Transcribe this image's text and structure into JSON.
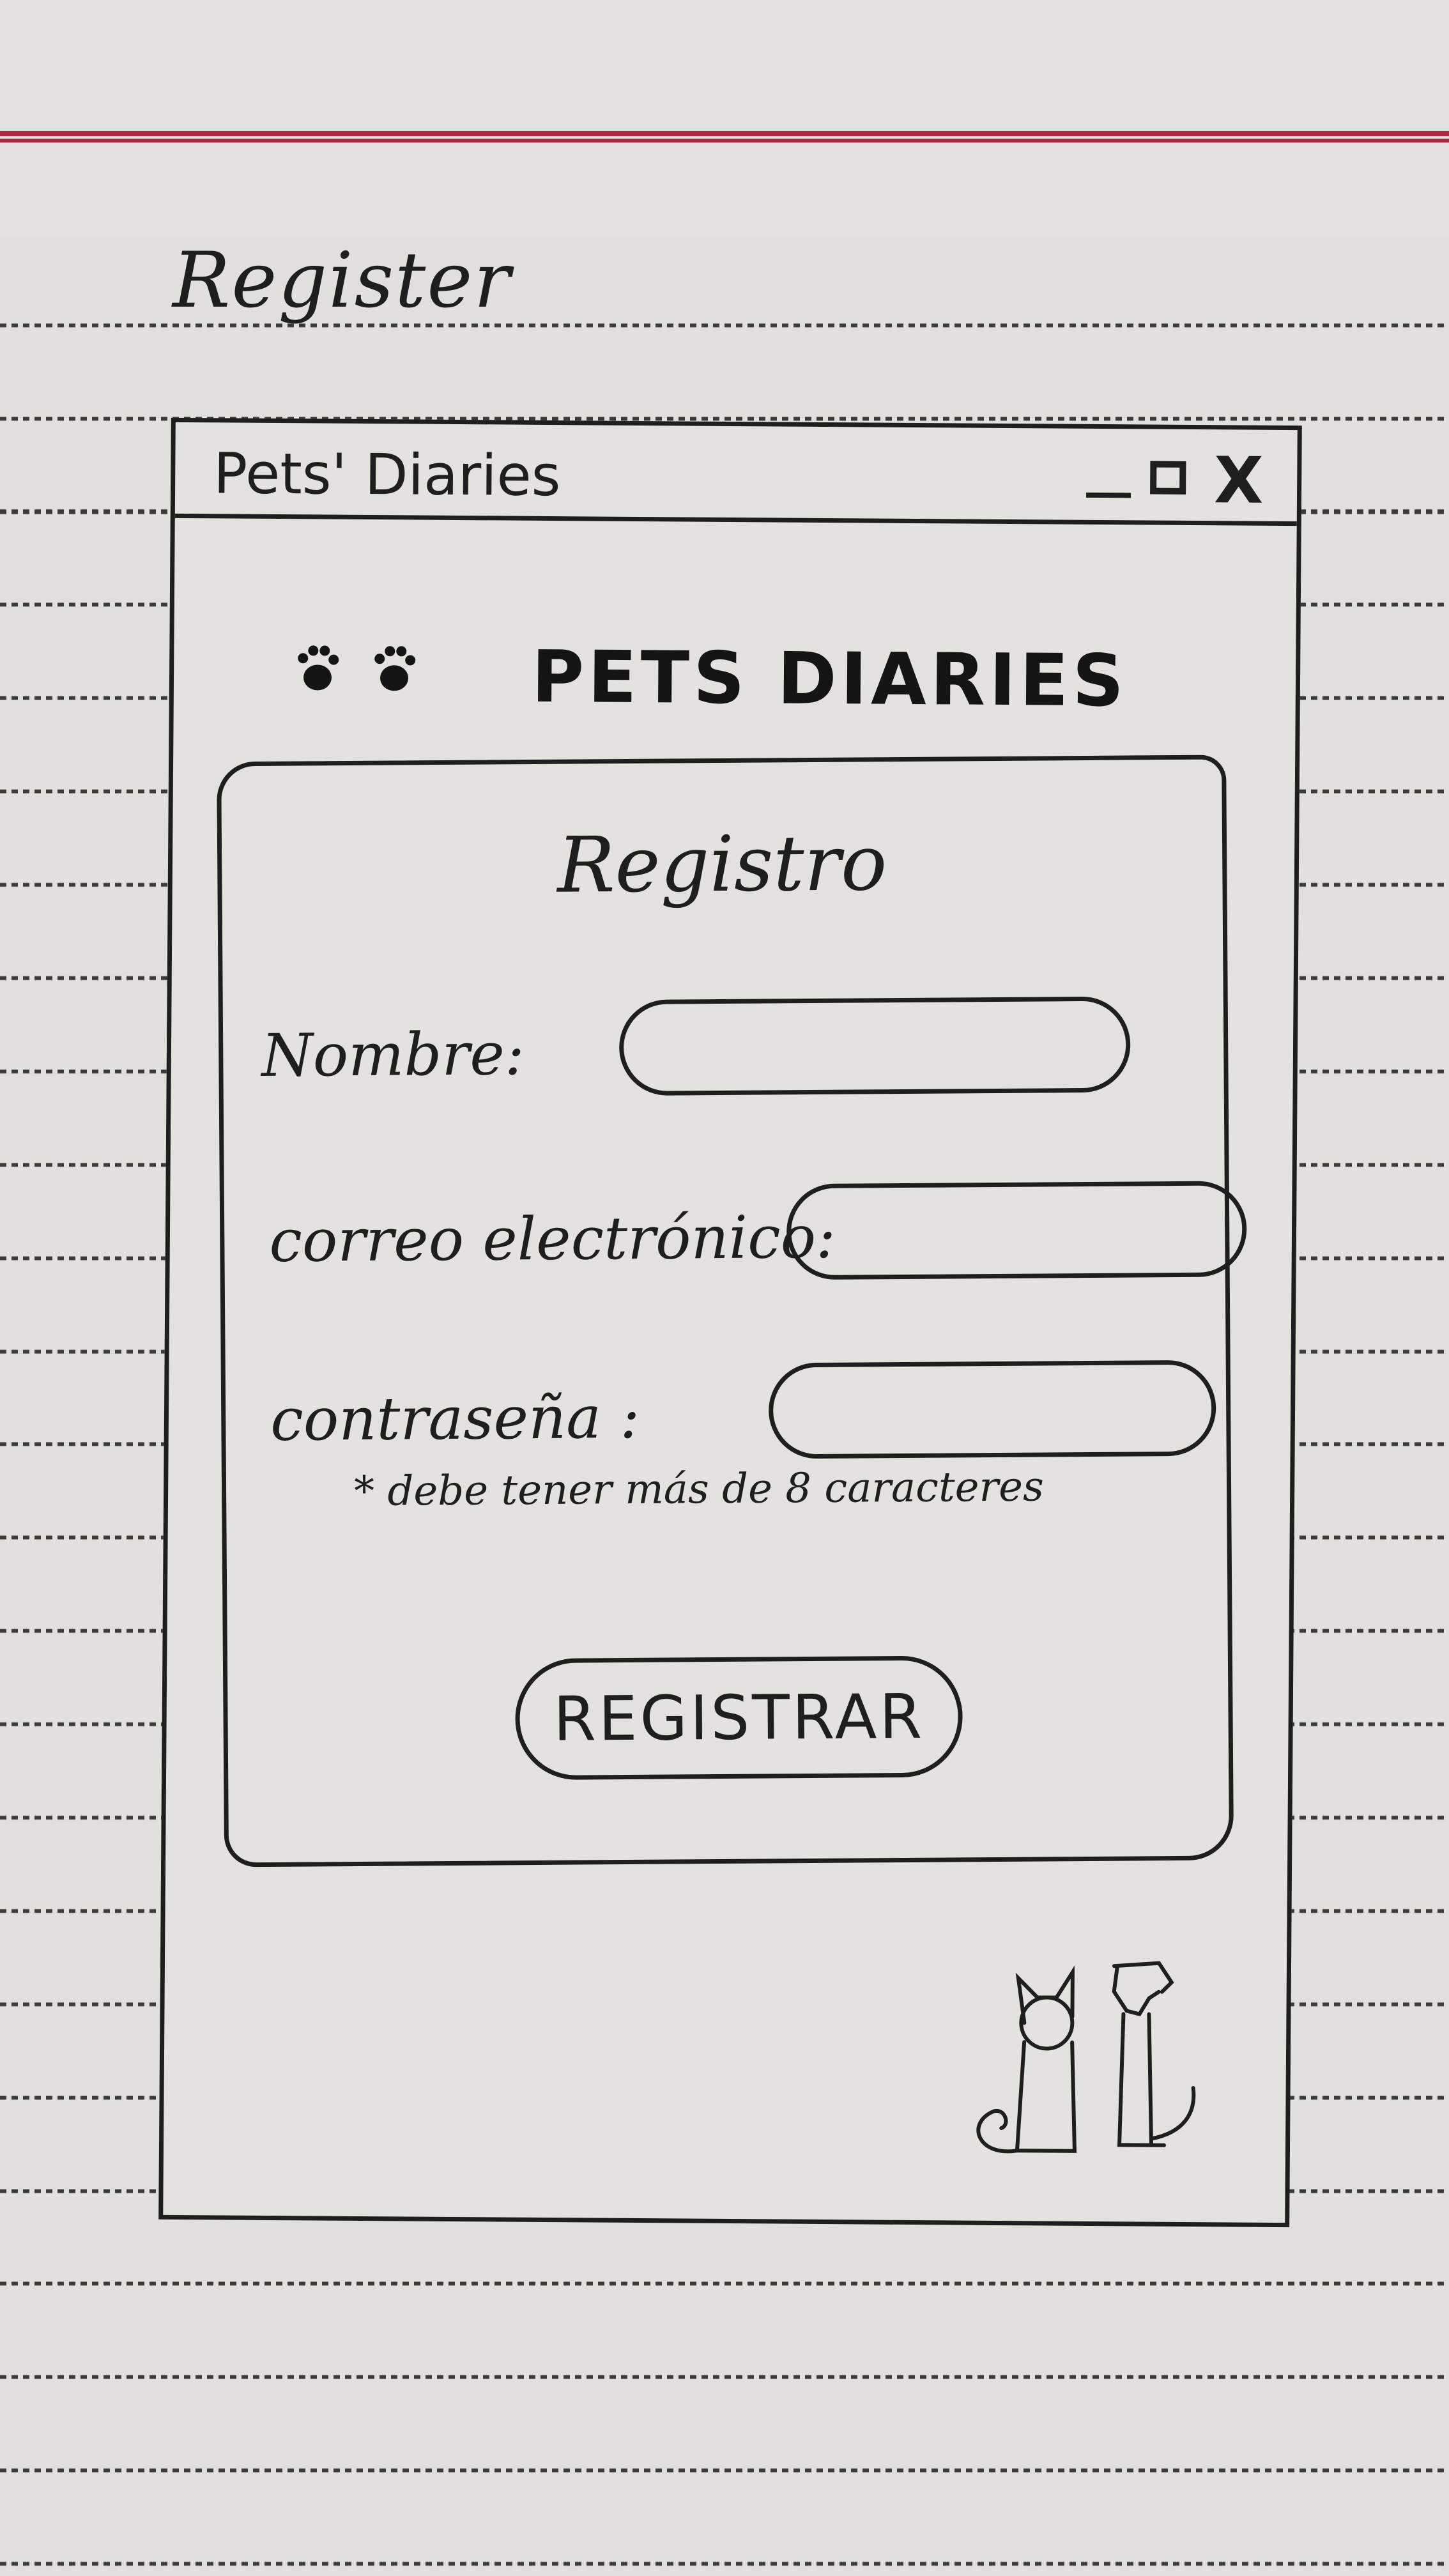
{
  "page": {
    "heading": "Register"
  },
  "window": {
    "title": "Pets' Diaries",
    "controls": {
      "minimize_icon": "minimize-icon",
      "maximize_icon": "maximize-icon",
      "close_icon": "close-icon",
      "close_glyph": "X"
    }
  },
  "app": {
    "name": "PETS DIARIES",
    "logo_icon": "paw-print-icon"
  },
  "form": {
    "title": "Registro",
    "fields": [
      {
        "label": "Nombre:",
        "value": ""
      },
      {
        "label": "correo electrónico:",
        "value": ""
      },
      {
        "label": "contraseña :",
        "value": "",
        "hint": "* debe tener más de 8 caracteres"
      }
    ],
    "submit_label": "REGISTRAR"
  },
  "illustration": {
    "icon": "cat-and-dog-icon"
  },
  "colors": {
    "ink": "#1e1e1e",
    "paper": "#e2e0dc",
    "margin_line": "#a8283c"
  }
}
